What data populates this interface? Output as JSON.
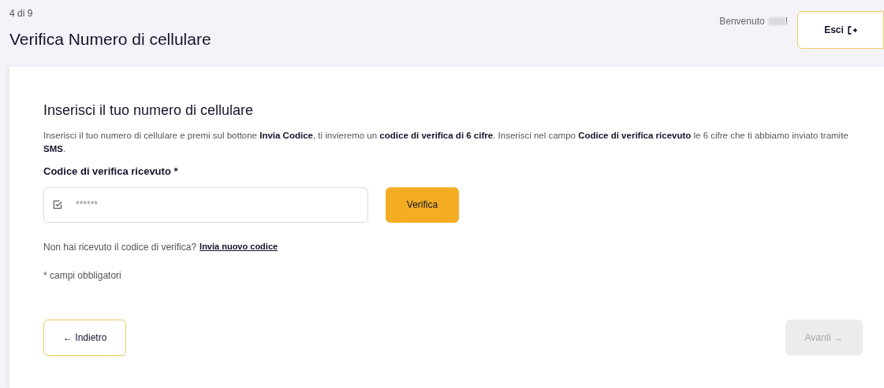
{
  "header": {
    "step": "4 di 9",
    "title": "Verifica Numero di cellulare",
    "welcome": "Benvenuto",
    "welcome_end": "!",
    "logout": "Esci"
  },
  "form": {
    "heading": "Inserisci il tuo numero di cellulare",
    "intro": "Inserisci il tuo numero di cellulare e premi sul bottone **Invia Codice**, ti invieremo un **codice di verifica di 6 cifre**. Inserisci nel campo **Codice di verifica ricevuto** le 6 cifre che ti abbiamo inviato tramite **SMS**.",
    "field_label": "Codice di verifica ricevuto *",
    "placeholder": "******",
    "verify_button": "Verifica",
    "resend_text": "Non hai ricevuto il codice di verifica?",
    "resend_link": "Invia nuovo codice",
    "required_note": "* campi obbligatori"
  },
  "nav": {
    "back": {
      "label": "← Indietro",
      "disabled": false
    },
    "next": {
      "label": "Avanti →",
      "disabled": true
    }
  }
}
